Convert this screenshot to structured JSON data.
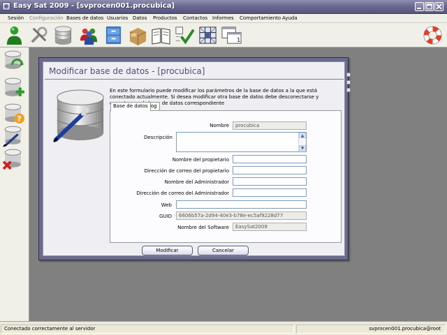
{
  "window": {
    "title": "Easy Sat 2009 - [svprocen001.procubica]",
    "controls": [
      "minimize",
      "maximize",
      "close"
    ]
  },
  "menu": [
    {
      "label": "Sesión",
      "enabled": true
    },
    {
      "label": "Configuración",
      "enabled": false
    },
    {
      "label": "Bases de datos",
      "enabled": true
    },
    {
      "label": "Usuarios",
      "enabled": true
    },
    {
      "label": "Datos",
      "enabled": true
    },
    {
      "label": "Productos",
      "enabled": true
    },
    {
      "label": "Contactos",
      "enabled": true
    },
    {
      "label": "Informes",
      "enabled": true
    },
    {
      "label": "Comportamiento",
      "enabled": true
    },
    {
      "label": "Ayuda",
      "enabled": true
    }
  ],
  "toolbar": {
    "icons": [
      "user-login-icon",
      "tools-icon",
      "database-icon",
      "users-group-icon",
      "file-cabinet-icon",
      "box-icon",
      "book-icon",
      "checklist-icon",
      "network-grid-icon",
      "windows-icon"
    ],
    "help_icon": "lifebuoy-icon"
  },
  "sidebar": {
    "icons": [
      "database-refresh-icon",
      "database-add-icon",
      "database-help-icon",
      "database-edit-icon",
      "database-delete-icon"
    ]
  },
  "panel": {
    "title": "Modificar base de datos - [procubica]",
    "intro": "En este formulario puede modificar los parámetros de la base de datos a la que está conectado actualmente. Si desea modificar otra base de datos debe desconectarse y conectarse a la base de datos correspondiente",
    "tabs": [
      {
        "label": "Base de datos",
        "active": true
      },
      {
        "label": "Log",
        "active": false
      }
    ],
    "fields": {
      "nombre": {
        "label": "Nombre",
        "value": "procubica"
      },
      "descripcion": {
        "label": "Descripción",
        "value": ""
      },
      "nombre_propietario": {
        "label": "Nombre del propietario",
        "value": ""
      },
      "correo_propietario": {
        "label": "Dirección de correo del propietario",
        "value": ""
      },
      "nombre_administrador": {
        "label": "Nombre del Administrador",
        "value": ""
      },
      "correo_administrador": {
        "label": "Dirección de correo del Administrador",
        "value": ""
      },
      "web": {
        "label": "Web",
        "value": ""
      },
      "guid": {
        "label": "GUID",
        "value": "6606b57a-2d94-40e3-b78e-ec5af9228d77"
      },
      "software": {
        "label": "Nombre del Software",
        "value": "EasySat2009"
      }
    },
    "buttons": {
      "modify": "Modificar",
      "cancel": "Cancelar"
    }
  },
  "status": {
    "message": "Conectado correctamente al servidor",
    "connection": "svprocen001.procubica@root"
  },
  "colors": {
    "titlebar": "#6b6b92",
    "panel_frame": "#6b6b8e",
    "panel_title": "#4c4c78",
    "workspace": "#808080"
  }
}
